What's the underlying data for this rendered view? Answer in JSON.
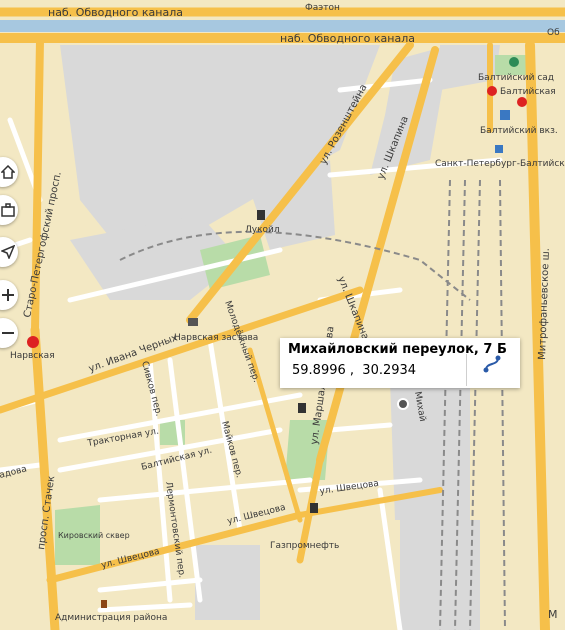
{
  "colors": {
    "block": "#f3e8c3",
    "industrial": "#d9d9d9",
    "park": "#b8dca8",
    "water": "#a7c8e0",
    "major_road": "#f6c04a",
    "minor_road": "#ffffff",
    "railway": "#a8a8a8"
  },
  "streets": {
    "obvodny_top": "наб. Обводного канала",
    "obvodny": "наб. Обводного канала",
    "fayton": "Фаэтон",
    "rozenshteina": "ул. Розенштейна",
    "shkapina": "ул. Шкапина",
    "shkapina2": "ул. Шкапина",
    "staro_pet": "Старо-Петергофский просп.",
    "mitrofan": "Митрофаньевское ш.",
    "ivana": "ул. Ивана Черных",
    "molodezh": "Молодёжный пер.",
    "sivkov": "Сивков пер.",
    "traktor": "Тракторная ул.",
    "baltiyskaya": "Балтийская ул.",
    "maykov": "Майков пер.",
    "marshala": "ул. Маршала Говорова",
    "shvetsova1": "ул. Швецова",
    "shvetsova2": "ул. Швецова",
    "shvetsova3": "ул. Швецова",
    "lermont": "Лермонтовский пер.",
    "stachek": "просп. Стачек",
    "sadovaya": "адова",
    "mikh_vert": "Михай",
    "ob": "Об",
    "m_right": "М"
  },
  "pois": {
    "balt_garden": "Балтийский сад",
    "baltiyskaya_metro": "Балтийская",
    "baltiysky_vokzal": "Балтийский вкз.",
    "spb_balt": "Санкт-Петербург-Балтийский",
    "lukoil": "Лукойл",
    "narvskaya": "Нарвская",
    "narv_zastava": "Нарвская застава",
    "gazprom": "Газпромнефть",
    "kirov_skver": "Кировский сквер",
    "admin": "Администрация района"
  },
  "controls": [
    {
      "name": "home-icon"
    },
    {
      "name": "briefcase-icon"
    },
    {
      "name": "navigation-arrow-icon"
    },
    {
      "name": "zoom-in-icon"
    },
    {
      "name": "zoom-out-icon"
    }
  ],
  "popup": {
    "address": "Михайловский переулок, 7 Б",
    "lat": "59.8996",
    "lon": "30.2934",
    "separator": " ,  "
  }
}
